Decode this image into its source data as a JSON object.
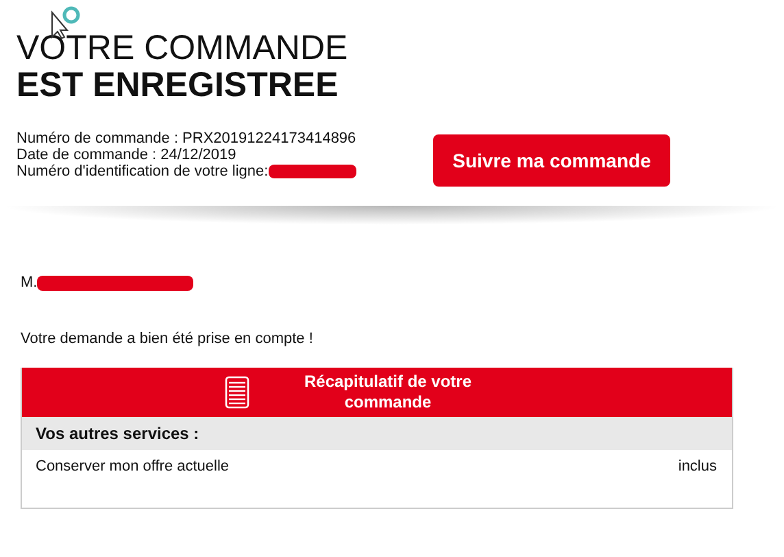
{
  "heading": {
    "line_1": "VOTRE COMMANDE",
    "line_2": "EST ENREGISTREE"
  },
  "order_info": [
    {
      "text": "Numéro de commande : PRX20191224173414896",
      "redacted": false
    },
    {
      "text": "Date de commande : 24/12/2019",
      "redacted": false
    },
    {
      "text": "Numéro d'identification de votre ligne:",
      "redacted": true
    }
  ],
  "track_button": {
    "label": "Suivre ma commande"
  },
  "customer": {
    "prefix": "M.",
    "redacted": true
  },
  "message": "Votre demande a bien été prise en compte !",
  "summary": {
    "title": "Récapitulatif de votre commande",
    "section": "Vos autres services :",
    "rows": [
      {
        "label": "Conserver mon offre actuelle",
        "value": "inclus"
      }
    ]
  }
}
